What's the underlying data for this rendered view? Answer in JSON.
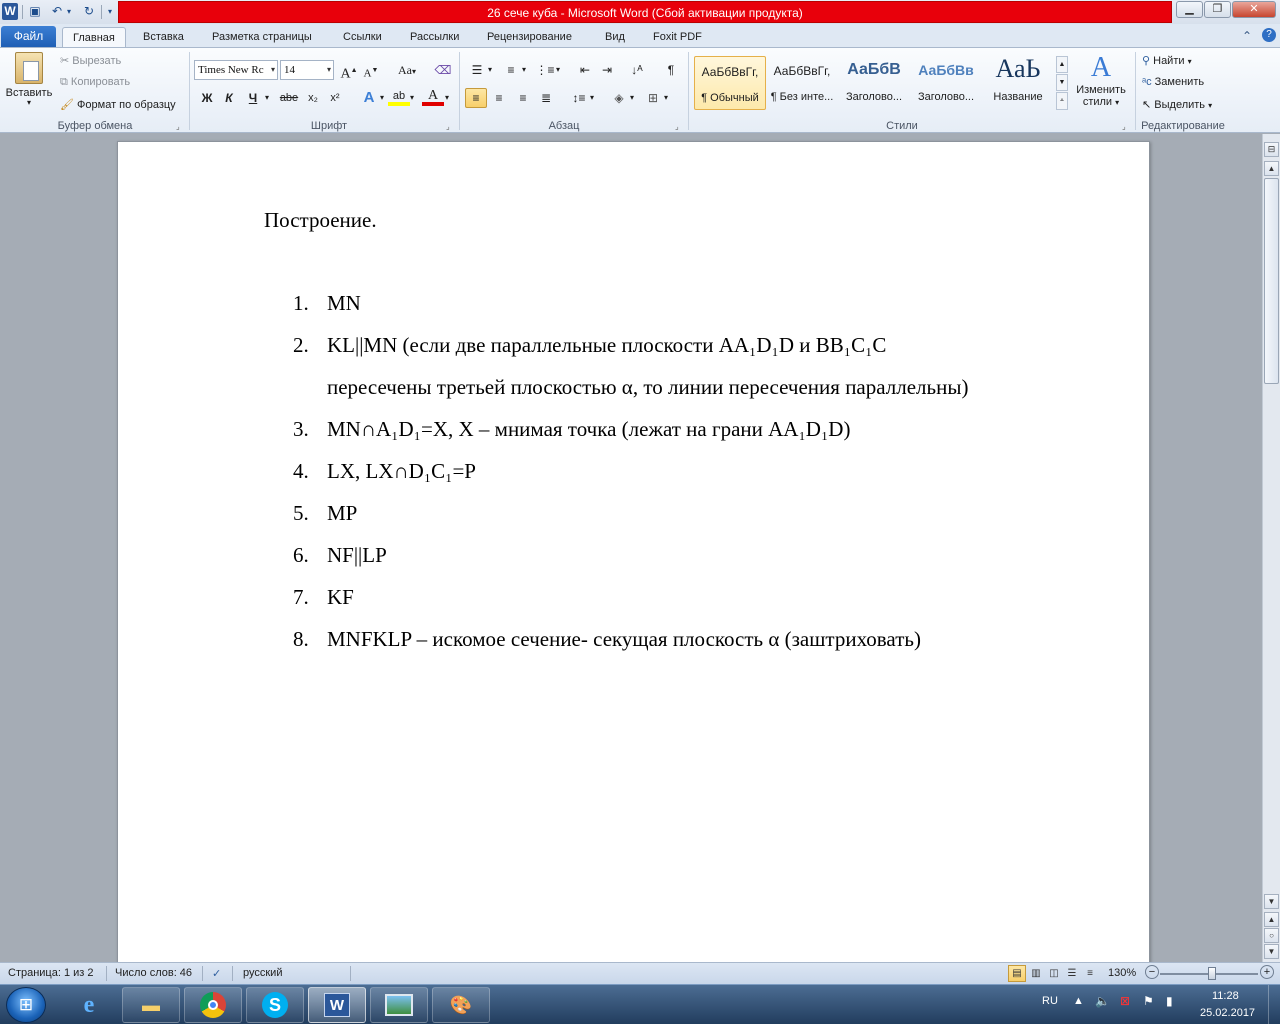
{
  "window": {
    "title": "26 сече куба - Microsoft Word (Сбой активации продукта)",
    "title_bar_color": "#e8000b"
  },
  "quick_access": {
    "icons": [
      "word-app-icon",
      "save-icon",
      "undo-icon",
      "redo-icon",
      "customize-icon"
    ]
  },
  "tabs": {
    "file": "Файл",
    "items": [
      "Главная",
      "Вставка",
      "Разметка страницы",
      "Ссылки",
      "Рассылки",
      "Рецензирование",
      "Вид",
      "Foxit PDF"
    ],
    "active_index": 0
  },
  "ribbon": {
    "clipboard": {
      "label": "Буфер обмена",
      "paste": "Вставить",
      "cut": "Вырезать",
      "copy": "Копировать",
      "format_painter": "Формат по образцу"
    },
    "font": {
      "label": "Шрифт",
      "font_name": "Times New Rc",
      "font_size": "14",
      "bold": "Ж",
      "italic": "К",
      "underline": "Ч",
      "strike": "abe",
      "subscript": "x₂",
      "superscript": "x²",
      "case": "Aa",
      "grow": "A",
      "shrink": "A",
      "effects": "A",
      "font_color": "A",
      "highlight": "ab"
    },
    "paragraph": {
      "label": "Абзац",
      "pilcrow": "¶"
    },
    "styles": {
      "label": "Стили",
      "items": [
        {
          "sample": "АаБбВвГг,",
          "name": "¶ Обычный"
        },
        {
          "sample": "АаБбВвГг,",
          "name": "¶ Без инте..."
        },
        {
          "sample": "АаБбВ",
          "name": "Заголово..."
        },
        {
          "sample": "АаБбВв",
          "name": "Заголово..."
        },
        {
          "sample": "АаЬ",
          "name": "Название"
        }
      ],
      "change_styles_line1": "Изменить",
      "change_styles_line2": "стили"
    },
    "editing": {
      "label": "Редактирование",
      "find": "Найти",
      "replace": "Заменить",
      "select": "Выделить"
    }
  },
  "document": {
    "heading": "Построение.",
    "items": [
      {
        "num": "1.",
        "text": "MN"
      },
      {
        "num": "2.",
        "text": "KL||MN  (если две параллельные плоскости AA₁D₁D  и BB₁C₁C",
        "cont": "пересечены третьей плоскостью α, то линии пересечения параллельны)"
      },
      {
        "num": "3.",
        "text": "MN∩A₁D₁=X,  X – мнимая точка (лежат на грани AA₁D₁D)"
      },
      {
        "num": "4.",
        "text": "LX, LX∩D₁C₁=P"
      },
      {
        "num": "5.",
        "text": "MP"
      },
      {
        "num": "6.",
        "text": "NF||LP"
      },
      {
        "num": "7.",
        "text": "KF"
      },
      {
        "num": "8.",
        "text": "MNFKLP  – искомое сечение- секущая плоскость α (заштриховать)"
      }
    ]
  },
  "statusbar": {
    "page": "Страница: 1 из 2",
    "words": "Число слов: 46",
    "language": "русский",
    "zoom": "130%",
    "zoom_minus": "−",
    "zoom_plus": "+"
  },
  "taskbar": {
    "apps": [
      "internet-explorer-icon",
      "file-explorer-icon",
      "chrome-icon",
      "skype-icon",
      "word-icon",
      "photo-viewer-icon",
      "paint-icon"
    ],
    "active_app": "word-icon",
    "lang": "RU",
    "time": "11:28",
    "date": "25.02.2017"
  }
}
